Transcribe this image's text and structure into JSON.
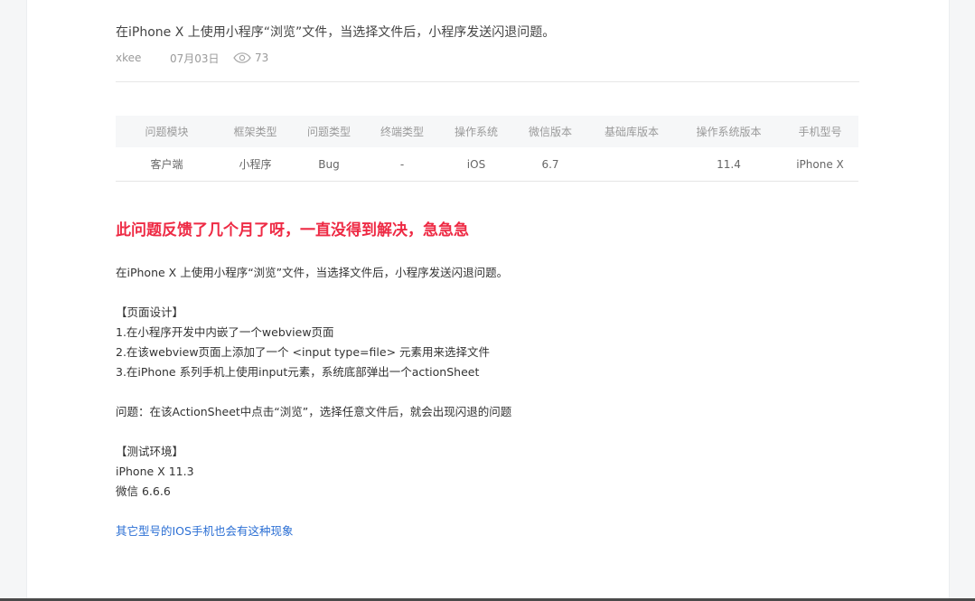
{
  "post": {
    "title": "在iPhone X 上使用小程序“浏览”文件，当选择文件后，小程序发送闪退问题。",
    "author": "xkee",
    "date": "07月03日",
    "views": "73"
  },
  "table": {
    "headers": [
      "问题模块",
      "框架类型",
      "问题类型",
      "终端类型",
      "操作系统",
      "微信版本",
      "基础库版本",
      "操作系统版本",
      "手机型号"
    ],
    "row": [
      "客户端",
      "小程序",
      "Bug",
      "-",
      "iOS",
      "6.7",
      "",
      "11.4",
      "iPhone X"
    ]
  },
  "content": {
    "headline": "此问题反馈了几个月了呀，一直没得到解决，急急急",
    "intro": "在iPhone X 上使用小程序“浏览”文件，当选择文件后，小程序发送闪退问题。",
    "design_heading": "【页面设计】",
    "design_items": [
      "1.在小程序开发中内嵌了一个webview页面",
      "2.在该webview页面上添加了一个 <input type=file> 元素用来选择文件",
      "3.在iPhone 系列手机上使用input元素，系统底部弹出一个actionSheet"
    ],
    "problem": "问题：在该ActionSheet中点击“浏览”，选择任意文件后，就会出现闪退的问题",
    "env_heading": "【测试环境】",
    "env_items": [
      "iPhone X 11.3",
      "微信 6.6.6"
    ],
    "link": "其它型号的IOS手机也会有这种现象"
  },
  "icons": {
    "views": "eye-icon"
  }
}
